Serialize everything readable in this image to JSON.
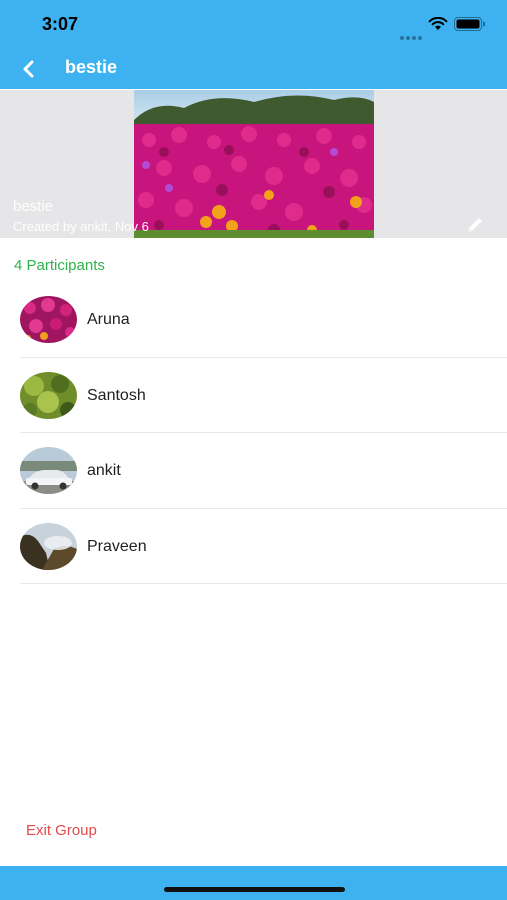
{
  "status_bar": {
    "time": "3:07",
    "icons": [
      "cellular-dots-icon",
      "wifi-icon",
      "battery-icon"
    ]
  },
  "nav": {
    "back_icon": "chevron-left-icon",
    "title": "bestie"
  },
  "group_header": {
    "name": "bestie",
    "created_by": "Created by ankit, Nov 6",
    "edit_icon": "pencil-icon",
    "photo": "flower-field-photo"
  },
  "participants": {
    "count_label": "4 Participants",
    "items": [
      {
        "name": "Aruna",
        "avatar": "pink-flowers-photo"
      },
      {
        "name": "Santosh",
        "avatar": "green-plant-photo"
      },
      {
        "name": "ankit",
        "avatar": "white-car-photo"
      },
      {
        "name": "Praveen",
        "avatar": "mountain-mist-photo"
      }
    ]
  },
  "actions": {
    "exit_label": "Exit Group"
  },
  "colors": {
    "header_blue": "#3eb2f0",
    "participants_green": "#2fb34a",
    "exit_red": "#e44a4a"
  }
}
